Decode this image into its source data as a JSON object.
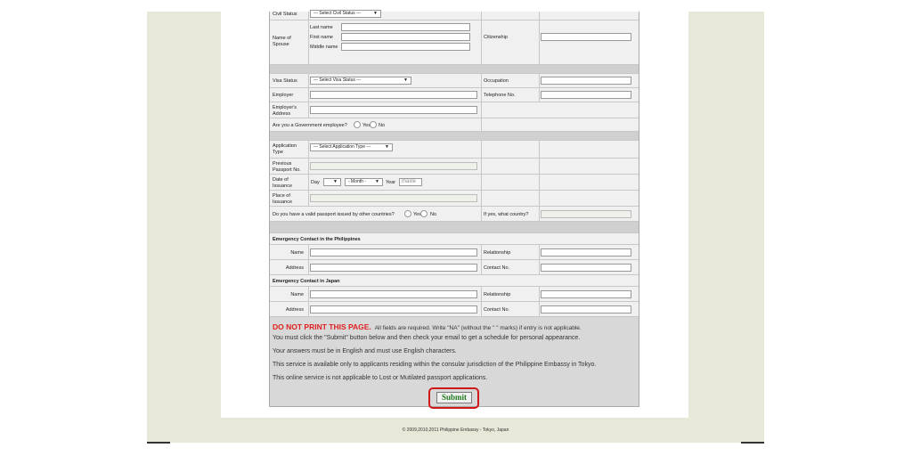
{
  "civil_status": {
    "label": "Civil Status",
    "select": "--- Select Civil Status ---"
  },
  "spouse": {
    "label": "Name of Spouse",
    "last": "Last name",
    "first": "First name",
    "middle": "Middle name"
  },
  "citizenship": {
    "label": "Citizenship"
  },
  "visa_status": {
    "label": "Visa Status",
    "select": "--- Select Visa Status ---"
  },
  "occupation": {
    "label": "Occupation"
  },
  "employer": {
    "label": "Employer"
  },
  "telephone": {
    "label": "Telephone No."
  },
  "employer_address": {
    "label": "Employer's Address"
  },
  "gov_employee": {
    "label": "Are you a Government employee?",
    "yes": "Yes",
    "no": "No"
  },
  "application_type": {
    "label": "Application Type",
    "select": "--- Select Application Type ---"
  },
  "previous_passport": {
    "label": "Previous Passport No."
  },
  "date_of_issuance": {
    "label": "Date of Issuance",
    "day": "Day",
    "month": "- Month -",
    "year_label": "Year",
    "year_placeholder": "maxle"
  },
  "place_of_issuance": {
    "label": "Place of Issuance"
  },
  "other_passport": {
    "label": "Do you have a valid passport issued by other countries?",
    "yes": "Yes",
    "no": "No",
    "if_yes": "If yes, what country?"
  },
  "emergency_ph": {
    "title": "Emergency Contact in the Philippines",
    "name": "Name",
    "address": "Address",
    "relationship": "Relationship",
    "contact": "Contact No."
  },
  "emergency_jp": {
    "title": "Emergency Contact in Japan",
    "name": "Name",
    "address": "Address",
    "relationship": "Relationship",
    "contact": "Contact No."
  },
  "notes": {
    "warning": "DO NOT PRINT THIS PAGE.",
    "required": "All fields are required. Write \"NA\" (without the \" \" marks) if entry is not applicable.",
    "line2": "You must click the \"Submit\" button below and then check your email to get a schedule for personal appearance.",
    "line3": "Your answers must be in English and must use English characters.",
    "line4": "This service is available only to applicants residing within the consular jurisdiction of the Philippine Embassy in Tokyo.",
    "line5": "This online service is not applicable to Lost or Mutilated passport applications."
  },
  "submit_label": "Submit",
  "footer": "© 2009,2010,2011 Philippine Embassy - Tokyo, Japan"
}
